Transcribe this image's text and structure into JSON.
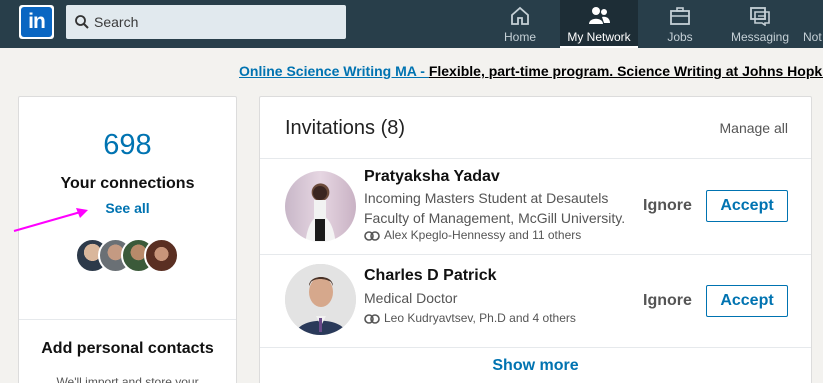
{
  "nav": {
    "logo_text": "in",
    "search_placeholder": "Search",
    "items": [
      {
        "label": "Home",
        "icon": "home-icon"
      },
      {
        "label": "My Network",
        "icon": "people-icon",
        "active": true
      },
      {
        "label": "Jobs",
        "icon": "briefcase-icon"
      },
      {
        "label": "Messaging",
        "icon": "chat-icon"
      },
      {
        "label": "Not",
        "icon": "bell-icon"
      }
    ]
  },
  "ad": {
    "link_text": "Online Science Writing MA - ",
    "body_text": "Flexible, part-time program. Science Writing at Johns Hopkins"
  },
  "connections": {
    "count": "698",
    "label": "Your connections",
    "see_all": "See all"
  },
  "contacts": {
    "title": "Add personal contacts",
    "subtitle": "We'll import and store your"
  },
  "invitations": {
    "title": "Invitations (8)",
    "manage_all": "Manage all",
    "items": [
      {
        "name": "Pratyaksha Yadav",
        "headline": "Incoming Masters Student at Desautels Faculty of Management, McGill University.",
        "mutual": "Alex Kpeglo-Hennessy and 11 others"
      },
      {
        "name": "Charles D Patrick",
        "headline": "Medical Doctor",
        "mutual": "Leo Kudryavtsev, Ph.D and 4 others"
      }
    ],
    "ignore_label": "Ignore",
    "accept_label": "Accept",
    "show_more": "Show more"
  },
  "colors": {
    "nav_bg": "#283e4a",
    "accent": "#0073b1",
    "annotation_arrow": "#ff00ff"
  }
}
